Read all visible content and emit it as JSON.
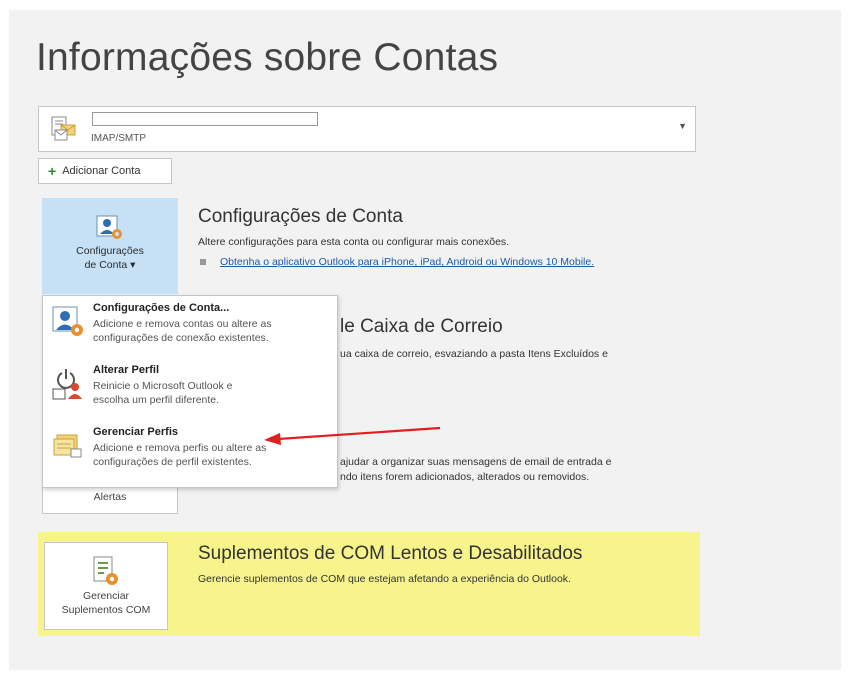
{
  "page": {
    "title": "Informações sobre Contas"
  },
  "account_selector": {
    "account_type": "IMAP/SMTP",
    "icon": "account-envelope-icon"
  },
  "add_account": {
    "label": "Adicionar Conta",
    "icon": "plus-icon"
  },
  "account_settings": {
    "tile_label_line1": "Configurações",
    "tile_label_line2": "de Conta ▾",
    "title": "Configurações de Conta",
    "description": "Altere configurações para esta conta ou configurar mais conexões.",
    "link": "Obtenha o aplicativo Outlook para iPhone, iPad, Android ou Windows 10 Mobile."
  },
  "mailbox_section": {
    "title_partial": "le Caixa de Correio",
    "description_partial": "ua caixa de correio, esvaziando a pasta Itens Excluídos e"
  },
  "rules_section": {
    "tile_label": "Alertas",
    "description_line1": "ajudar a organizar suas mensagens de email de entrada e",
    "description_line2": "ndo itens forem adicionados, alterados ou removidos."
  },
  "com_addins": {
    "tile_label_line1": "Gerenciar",
    "tile_label_line2": "Suplementos COM",
    "title": "Suplementos de COM Lentos e Desabilitados",
    "description": "Gerencie suplementos de COM que estejam afetando a experiência do Outlook."
  },
  "dropdown_menu": {
    "items": [
      {
        "title": "Configurações de Conta...",
        "description": "Adicione e remova contas ou altere as\nconfigurações de conexão existentes.",
        "icon": "account-settings-icon"
      },
      {
        "title": "Alterar Perfil",
        "description": "Reinicie o Microsoft Outlook e\nescolha um perfil diferente.",
        "icon": "change-profile-icon"
      },
      {
        "title": "Gerenciar Perfis",
        "description": "Adicione e remova perfis ou altere as\nconfigurações de perfil existentes.",
        "icon": "manage-profiles-icon"
      }
    ]
  },
  "colors": {
    "panel_bg": "#f2f2f2",
    "selected_tile": "#c6e1f5",
    "highlight_yellow": "#f7f48c",
    "link": "#1e5aa8",
    "annotation_arrow": "#e02020"
  }
}
